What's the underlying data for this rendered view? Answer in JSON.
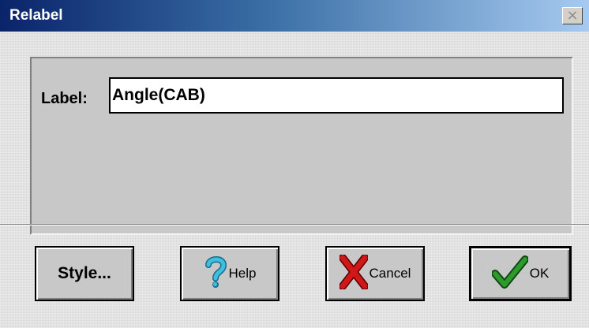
{
  "window": {
    "title": "Relabel",
    "close_glyph": "×"
  },
  "form": {
    "label_caption": "Label:",
    "label_value": "Angle(CAB)"
  },
  "buttons": {
    "style_label": "Style...",
    "help_label": "Help",
    "cancel_label": "Cancel",
    "ok_label": "OK"
  },
  "icons": {
    "help": "question-mark-icon",
    "cancel": "x-mark-icon",
    "ok": "checkmark-icon"
  },
  "colors": {
    "title_gradient_start": "#0a246a",
    "title_gradient_end": "#a6caf0",
    "help_icon": "#2aa8c8",
    "cancel_icon": "#c81818",
    "ok_icon": "#228822"
  }
}
